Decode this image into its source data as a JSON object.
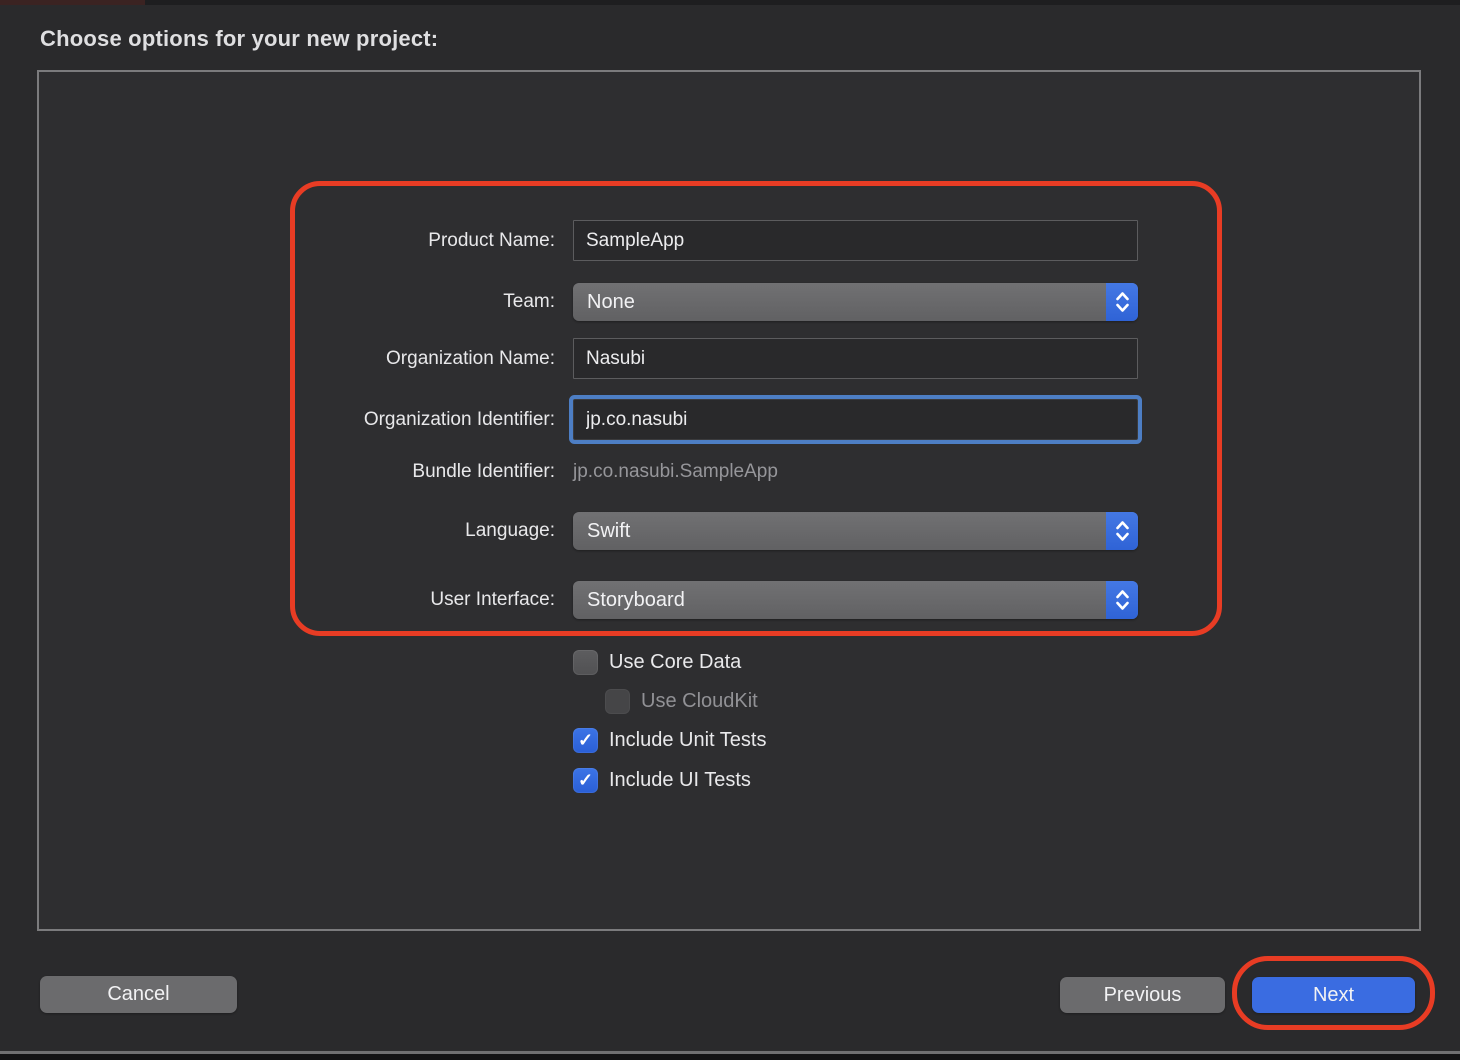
{
  "dialog": {
    "title": "Choose options for your new project:"
  },
  "form": {
    "product_name": {
      "label": "Product Name:",
      "value": "SampleApp"
    },
    "team": {
      "label": "Team:",
      "value": "None"
    },
    "organization_name": {
      "label": "Organization Name:",
      "value": "Nasubi"
    },
    "organization_identifier": {
      "label": "Organization Identifier:",
      "value": "jp.co.nasubi",
      "focused": true
    },
    "bundle_identifier": {
      "label": "Bundle Identifier:",
      "value": "jp.co.nasubi.SampleApp"
    },
    "language": {
      "label": "Language:",
      "value": "Swift"
    },
    "user_interface": {
      "label": "User Interface:",
      "value": "Storyboard"
    },
    "checkboxes": [
      {
        "label": "Use Core Data",
        "checked": false,
        "disabled": false
      },
      {
        "label": "Use CloudKit",
        "checked": false,
        "disabled": true
      },
      {
        "label": "Include Unit Tests",
        "checked": true,
        "disabled": false
      },
      {
        "label": "Include UI Tests",
        "checked": true,
        "disabled": false
      }
    ]
  },
  "footer": {
    "cancel_label": "Cancel",
    "previous_label": "Previous",
    "next_label": "Next"
  },
  "colors": {
    "annotation_red": "#e83c24",
    "focus_ring_blue": "#4d7ec4",
    "stepper_blue": "#3c71e0",
    "checkbox_blue": "#2e68e0",
    "next_button_blue": "#3a6ce1",
    "panel_background": "#2e2e30",
    "window_background": "#2a2a2c"
  }
}
